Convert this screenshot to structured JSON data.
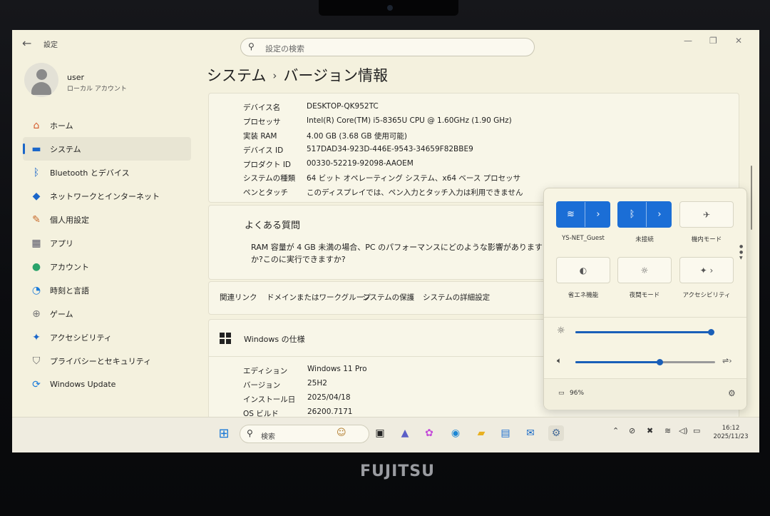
{
  "window": {
    "title": "設定",
    "minimize": "—",
    "maximize": "❐",
    "close": "✕"
  },
  "search": {
    "placeholder": "設定の検索"
  },
  "user": {
    "name": "user",
    "type": "ローカル アカウント"
  },
  "sidebar": {
    "items": [
      {
        "label": "ホーム",
        "icon": "home-icon",
        "glyph": "⌂",
        "color": "#d45b2b"
      },
      {
        "label": "システム",
        "icon": "monitor-icon",
        "glyph": "▬",
        "color": "#1a66c9",
        "active": true
      },
      {
        "label": "Bluetooth とデバイス",
        "icon": "bluetooth-icon",
        "glyph": "ᛒ",
        "color": "#1a66c9"
      },
      {
        "label": "ネットワークとインターネット",
        "icon": "wifi-icon",
        "glyph": "◆",
        "color": "#1a66c9"
      },
      {
        "label": "個人用設定",
        "icon": "brush-icon",
        "glyph": "✎",
        "color": "#c86a2a"
      },
      {
        "label": "アプリ",
        "icon": "apps-icon",
        "glyph": "▦",
        "color": "#556"
      },
      {
        "label": "アカウント",
        "icon": "account-icon",
        "glyph": "●",
        "color": "#2aa36a"
      },
      {
        "label": "時刻と言語",
        "icon": "globe-clock-icon",
        "glyph": "◔",
        "color": "#1a7ad9"
      },
      {
        "label": "ゲーム",
        "icon": "gamepad-icon",
        "glyph": "⊕",
        "color": "#777"
      },
      {
        "label": "アクセシビリティ",
        "icon": "accessibility-icon",
        "glyph": "✦",
        "color": "#1a66c9"
      },
      {
        "label": "プライバシーとセキュリティ",
        "icon": "shield-icon",
        "glyph": "⛉",
        "color": "#666"
      },
      {
        "label": "Windows Update",
        "icon": "update-icon",
        "glyph": "⟳",
        "color": "#1a7ad9"
      }
    ]
  },
  "breadcrumb": {
    "parent": "システム",
    "current": "バージョン情報"
  },
  "device_specs": [
    {
      "label": "デバイス名",
      "value": "DESKTOP-QK952TC"
    },
    {
      "label": "プロセッサ",
      "value": "Intel(R) Core(TM) i5-8365U CPU @ 1.60GHz (1.90 GHz)"
    },
    {
      "label": "実装 RAM",
      "value": "4.00 GB (3.68 GB 使用可能)"
    },
    {
      "label": "デバイス ID",
      "value": "517DAD34-923D-446E-9543-34659F82BBE9"
    },
    {
      "label": "プロダクト ID",
      "value": "00330-52219-92098-AAOEM"
    },
    {
      "label": "システムの種類",
      "value": "64 ビット オペレーティング システム、x64 ベース プロセッサ"
    },
    {
      "label": "ペンとタッチ",
      "value": "このディスプレイでは、ペン入力とタッチ入力は利用できません"
    }
  ],
  "faq": {
    "title": "よくある質問",
    "question": "RAM 容量が 4 GB 未満の場合、PC のパフォーマンスにどのような影響がありますか?このに実行できますか?"
  },
  "related_links": {
    "label": "関連リンク",
    "links": [
      "ドメインまたはワークグループ",
      "システムの保護",
      "システムの詳細設定"
    ]
  },
  "windows_spec": {
    "title": "Windows の仕様",
    "rows": [
      {
        "label": "エディション",
        "value": "Windows 11 Pro"
      },
      {
        "label": "バージョン",
        "value": "25H2"
      },
      {
        "label": "インストール日",
        "value": "2025/04/18"
      },
      {
        "label": "OS ビルド",
        "value": "26200.7171"
      }
    ]
  },
  "quick_settings": {
    "tiles": [
      {
        "label": "YS-NET_Guest",
        "icon": "wifi-icon",
        "on": true
      },
      {
        "label": "未接続",
        "icon": "bluetooth-icon",
        "on": true
      },
      {
        "label": "機内モード",
        "icon": "airplane-icon",
        "on": false
      },
      {
        "label": "省エネ機能",
        "icon": "energy-saver-icon",
        "on": false
      },
      {
        "label": "夜間モード",
        "icon": "night-light-icon",
        "on": false
      },
      {
        "label": "アクセシビリティ",
        "icon": "accessibility-icon",
        "on": false
      }
    ],
    "brightness": 1.0,
    "volume": 0.6,
    "battery": "96%"
  },
  "taskbar": {
    "search_placeholder": "検索",
    "time": "16:12",
    "date": "2025/11/23"
  },
  "brand": "FUJITSU"
}
